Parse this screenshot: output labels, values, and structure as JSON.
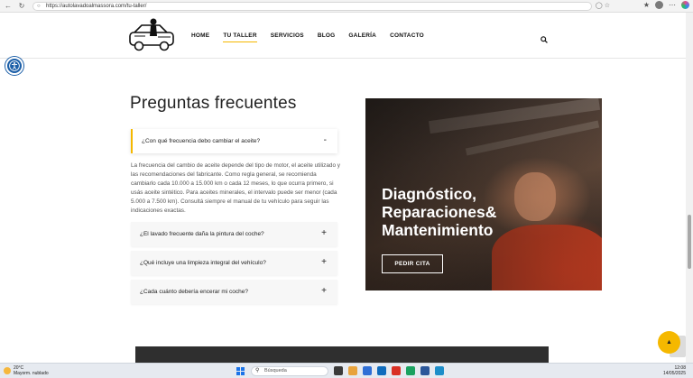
{
  "browser": {
    "url": "https://autolavadoalmassora.com/tu-taller/"
  },
  "nav": {
    "items": [
      "HOME",
      "TU TALLER",
      "SERVICIOS",
      "BLOG",
      "GALERÍA",
      "CONTACTO"
    ],
    "active": "TU TALLER"
  },
  "faq": {
    "title": "Preguntas frecuentes",
    "open_question": "¿Con qué frecuencia debo cambiar el aceite?",
    "open_sign": "-",
    "answer": "La frecuencia del cambio de aceite depende del tipo de motor, el aceite utilizado y las recomendaciones del fabricante. Como regla general, se recomienda cambiarlo cada 10.000 a 15.000 km o cada 12 meses, lo que ocurra primero, si usás aceite sintético. Para aceites minerales, el intervalo puede ser menor (cada 5.000 a 7.500 km). Consultá siempre el manual de tu vehículo para seguir las indicaciones exactas.",
    "questions": [
      {
        "text": "¿El lavado frecuente daña la pintura del coche?",
        "sign": "+"
      },
      {
        "text": "¿Qué incluye una limpieza integral del vehículo?",
        "sign": "+"
      },
      {
        "text": "¿Cada cuánto debería encerar mi coche?",
        "sign": "+"
      }
    ]
  },
  "promo": {
    "headline_line1": "Diagnóstico,",
    "headline_line2": "Reparaciones&",
    "headline_line3": "Mantenimiento",
    "cta": "PEDIR CITA"
  },
  "taskbar": {
    "weather_temp": "20°C",
    "weather_desc": "Mayorm. nublado",
    "search_placeholder": "Búsqueda",
    "time": "12:08",
    "date": "14/05/2025"
  },
  "colors": {
    "accent": "#f5b800",
    "accessibility": "#1c5fa8",
    "dark_strip": "#2f2f2f"
  }
}
